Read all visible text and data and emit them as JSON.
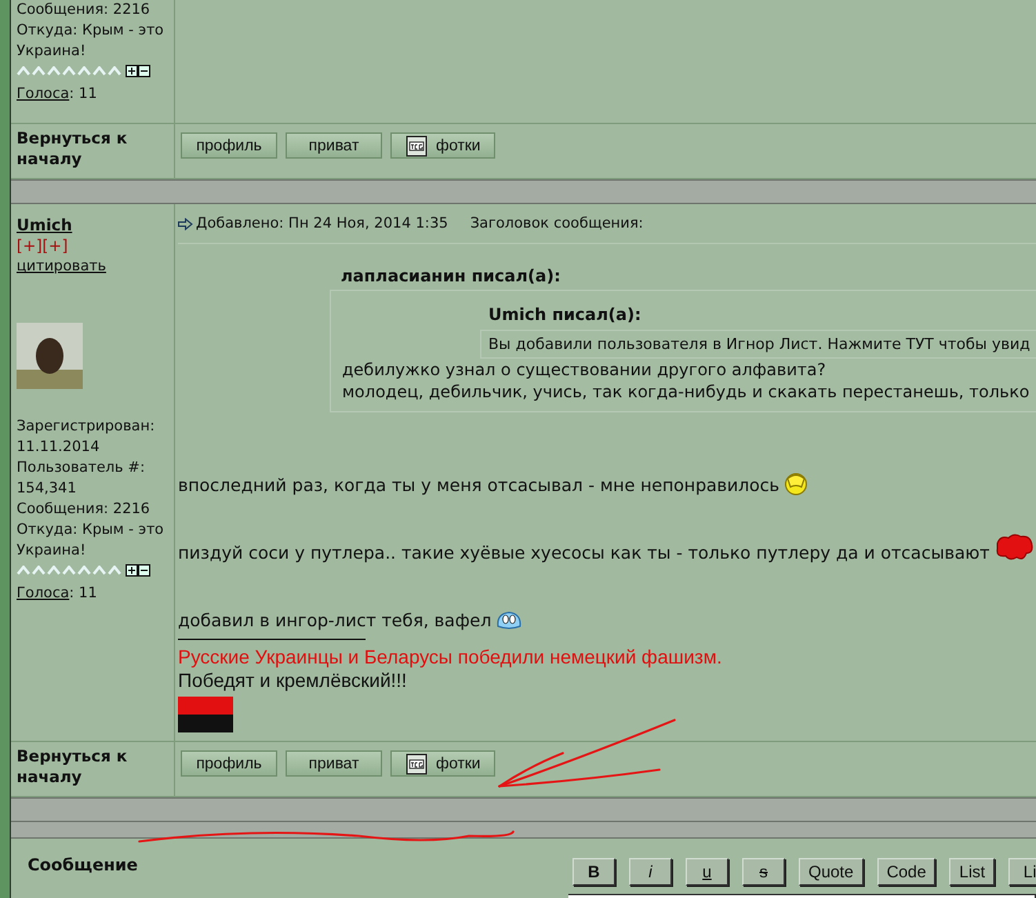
{
  "previous_post": {
    "profile_lines": [
      "Сообщения: 2216",
      "Откуда: Крым - это Украина!"
    ],
    "votes_label": "Голоса",
    "votes_count": ": 11",
    "back_to_top": "Вернуться к началу",
    "buttons": [
      {
        "label": "профиль",
        "kind": "text"
      },
      {
        "label": "приват",
        "kind": "text"
      },
      {
        "label": "фотки",
        "kind": "photos"
      }
    ]
  },
  "post": {
    "author": "Umich",
    "rate_links": "[+][+]",
    "quote_link": "цитировать",
    "profile_lines": [
      "Зарегистрирован: 11.11.2014",
      "Пользователь #: 154,341",
      "Сообщения: 2216",
      "Откуда: Крым - это Украина!"
    ],
    "votes_label": "Голоса",
    "votes_count": ": 11",
    "posted": "Добавлено: Пн 24 Ноя, 2014 1:35",
    "subject_label": "Заголовок сообщения:",
    "quote": {
      "author": "лапласианин писал(а):",
      "nested": {
        "author": "Umich писал(а):",
        "text": "Вы добавили пользователя в Игнор Лист. Нажмите ТУТ чтобы увид"
      },
      "lines": [
        "дебилужко узнал о существовании другого алфавита?",
        "молодец, дебильчик, учись, так когда-нибудь и скакать перестанешь, только"
      ]
    },
    "body": [
      {
        "text": "впоследний раз, когда ты у меня отсасывал - мне непонравилось",
        "kind": "facepalm"
      },
      {
        "text": "пиздуй соси у путлера.. такие хуёвые хуесосы как ты - только путлеру да и отсасывают",
        "kind": "splat"
      },
      {
        "text": "добавил в ингор-лист тебя, вафел",
        "kind": "blob"
      }
    ],
    "signature": {
      "highlight": "Русские Украинцы и Беларусы победили немецкий фашизм.",
      "text": "Победят и кремлёвский!!!"
    },
    "back_to_top": "Вернуться к началу",
    "buttons": [
      {
        "label": "профиль",
        "kind": "text"
      },
      {
        "label": "приват",
        "kind": "text"
      },
      {
        "label": "фотки",
        "kind": "photos"
      }
    ]
  },
  "reply": {
    "label": "Сообщение",
    "toolbar": [
      {
        "label": "B",
        "kind": "bold"
      },
      {
        "label": "i",
        "kind": "italic"
      },
      {
        "label": "u",
        "kind": "underline"
      },
      {
        "label": "s",
        "kind": "strike"
      },
      {
        "label": "Quote",
        "kind": "plain"
      },
      {
        "label": "Code",
        "kind": "plain"
      },
      {
        "label": "List",
        "kind": "plain"
      },
      {
        "label": "Li",
        "kind": "plain"
      }
    ]
  }
}
